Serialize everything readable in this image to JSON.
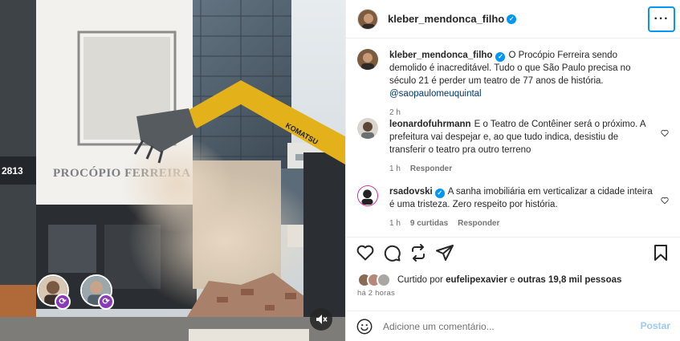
{
  "post": {
    "author": "kleber_mendonca_filho",
    "more_label": "···"
  },
  "media": {
    "storefront_number": "2813",
    "storefront_sign": "PROCÓPIO FERREIRA",
    "excavator_brand": "KOMATSU",
    "icons": [
      "remix-icon",
      "mute-icon"
    ]
  },
  "caption": {
    "username": "kleber_mendonca_filho",
    "text": "O Procópio Ferreira sendo demolido é inacreditável. Tudo o que São Paulo precisa no século 21 é perder um teatro de 77 anos de história.",
    "mention": "@saopaulomeuquintal",
    "time": "2 h"
  },
  "comments": [
    {
      "username": "leonardofuhrmann",
      "text": "E o Teatro de Contêiner será o próximo. A prefeitura vai despejar e, ao que tudo indica, desistiu de transferir o teatro pra outro terreno",
      "time": "1 h",
      "likes": "",
      "reply_label": "Responder"
    },
    {
      "username": "rsadovski",
      "text": "A sanha imobiliária em verticalizar a cidade inteira é uma tristeza. Zero respeito por história.",
      "time": "1 h",
      "likes": "9 curtidas",
      "reply_label": "Responder"
    }
  ],
  "likes_line": {
    "prefix": "Curtido por",
    "user": "eufelipexavier",
    "joiner": "e",
    "others": "outras 19,8 mil pessoas"
  },
  "posted_ago": "há 2 horas",
  "composer": {
    "placeholder": "Adicione um comentário...",
    "post_label": "Postar"
  },
  "colors": {
    "accent": "#0095f6",
    "post_disabled": "#9ccaf2",
    "mention": "#00376b"
  }
}
